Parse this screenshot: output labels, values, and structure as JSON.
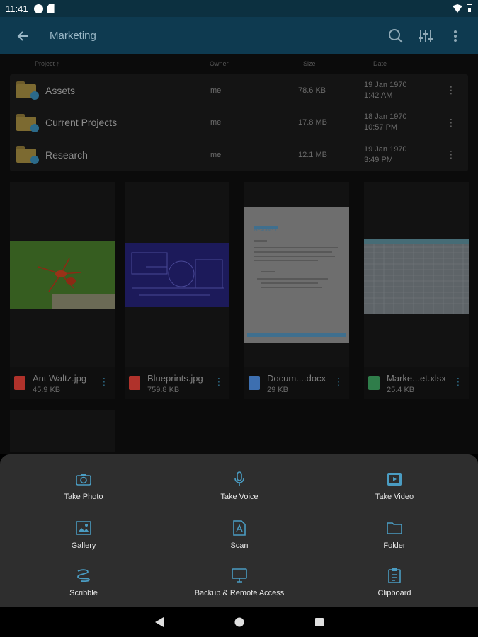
{
  "status": {
    "time": "11:41"
  },
  "appbar": {
    "title": "Marketing",
    "icons": [
      "back-arrow-icon",
      "search-icon",
      "tune-icon",
      "more-vert-icon"
    ]
  },
  "columns": {
    "project": "Project ↑",
    "owner": "Owner",
    "size": "Size",
    "date": "Date"
  },
  "folders": [
    {
      "name": "Assets",
      "owner": "me",
      "size": "78.6 KB",
      "date": "19 Jan 1970",
      "time": "1:42 AM"
    },
    {
      "name": "Current Projects",
      "owner": "me",
      "size": "17.8 MB",
      "date": "18 Jan 1970",
      "time": "10:57 PM"
    },
    {
      "name": "Research",
      "owner": "me",
      "size": "12.1 MB",
      "date": "19 Jan 1970",
      "time": "3:49 PM"
    }
  ],
  "files": [
    {
      "name": "Ant Waltz.jpg",
      "size": "45.9 KB",
      "type": "image"
    },
    {
      "name": "Blueprints.jpg",
      "size": "759.8 KB",
      "type": "image"
    },
    {
      "name": "Docum....docx",
      "size": "29 KB",
      "type": "word"
    },
    {
      "name": "Marke...et.xlsx",
      "size": "25.4 KB",
      "type": "excel"
    }
  ],
  "document_preview": {
    "heading": "HEADING 1"
  },
  "sheet": {
    "items": [
      {
        "label": "Take Photo",
        "icon": "camera-icon"
      },
      {
        "label": "Take Voice",
        "icon": "microphone-icon"
      },
      {
        "label": "Take Video",
        "icon": "video-icon"
      },
      {
        "label": "Gallery",
        "icon": "gallery-icon"
      },
      {
        "label": "Scan",
        "icon": "scan-document-icon"
      },
      {
        "label": "Folder",
        "icon": "folder-icon"
      },
      {
        "label": "Scribble",
        "icon": "scribble-icon"
      },
      {
        "label": "Backup & Remote Access",
        "icon": "monitor-icon"
      },
      {
        "label": "Clipboard",
        "icon": "clipboard-icon"
      }
    ]
  },
  "colors": {
    "accent": "#4a9cc2",
    "appbar": "#0e3a50",
    "sheet": "#2e2e2e"
  }
}
